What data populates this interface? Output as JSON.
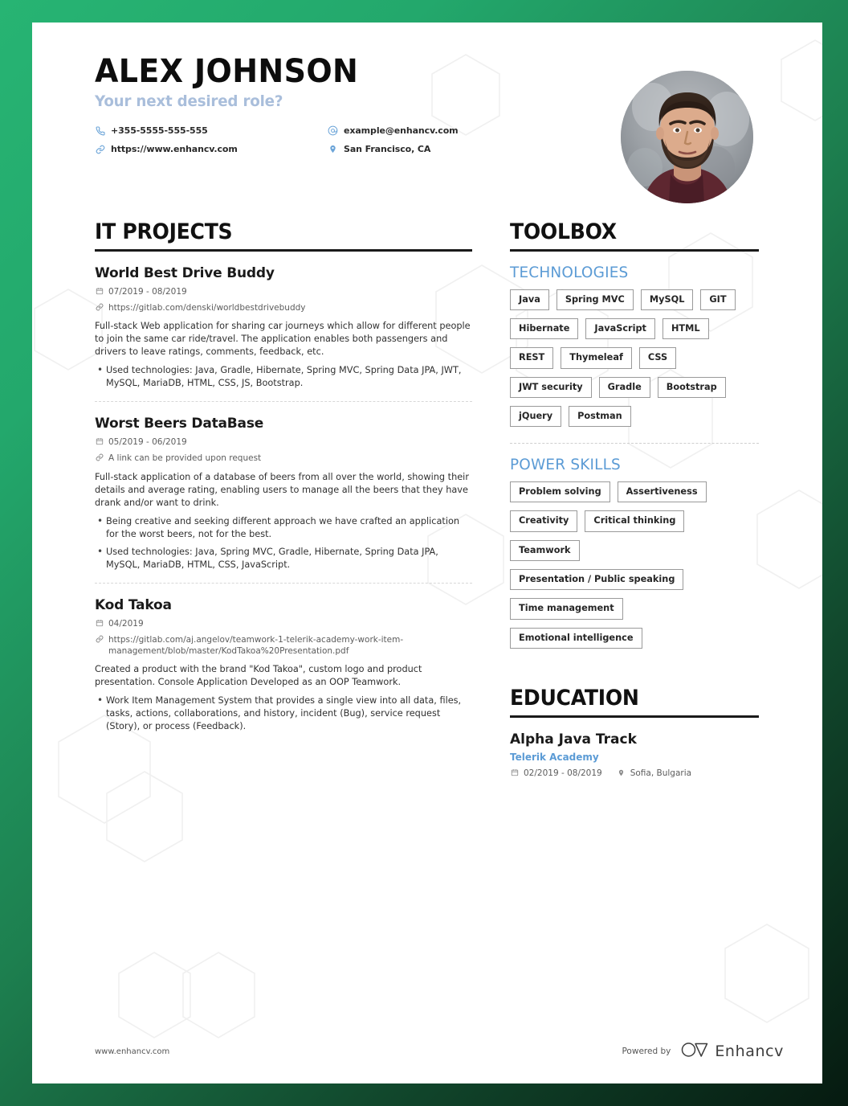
{
  "header": {
    "name": "ALEX JOHNSON",
    "subtitle": "Your next desired role?",
    "contacts": [
      {
        "icon": "phone-icon",
        "text": "+355-5555-555-555"
      },
      {
        "icon": "email-icon",
        "text": "example@enhancv.com"
      },
      {
        "icon": "link-icon",
        "text": "https://www.enhancv.com"
      },
      {
        "icon": "location-icon",
        "text": "San Francisco, CA"
      }
    ],
    "photo_alt": "Profile photo"
  },
  "projects": {
    "section_title": "IT PROJECTS",
    "items": [
      {
        "title": "World Best Drive Buddy",
        "date": "07/2019 - 08/2019",
        "link": "https://gitlab.com/denski/worldbestdrivebuddy",
        "description": "Full-stack Web application for sharing car journeys which allow for different people to join the same car ride/travel. The application enables both passengers and drivers to leave ratings, comments, feedback, etc.",
        "bullets": [
          "Used technologies: Java, Gradle, Hibernate, Spring MVC, Spring Data JPA, JWT, MySQL, MariaDB, HTML, CSS, JS, Bootstrap."
        ]
      },
      {
        "title": "Worst Beers DataBase",
        "date": "05/2019 - 06/2019",
        "link": "A link can be provided upon request",
        "description": "Full-stack application of a database of beers from all over the world, showing their details and average rating, enabling users to manage all the beers that they have drank and/or want to drink.",
        "bullets": [
          "Being creative and seeking different approach we have crafted an application for the worst beers, not for the best.",
          "Used technologies: Java, Spring MVC, Gradle, Hibernate, Spring Data JPA, MySQL, MariaDB, HTML, CSS, JavaScript."
        ]
      },
      {
        "title": "Kod Takoa",
        "date": "04/2019",
        "link": "https://gitlab.com/aj.angelov/teamwork-1-telerik-academy-work-item-management/blob/master/KodTakoa%20Presentation.pdf",
        "description": "Created a product with the brand \"Kod Takoa\", custom logo and product presentation. Console Application Developed as an OOP Teamwork.",
        "bullets": [
          "Work Item Management System that provides a single view into all data, files, tasks, actions, collaborations, and history, incident (Bug), service request (Story), or process (Feedback)."
        ]
      }
    ]
  },
  "toolbox": {
    "section_title": "TOOLBOX",
    "technologies_label": "TECHNOLOGIES",
    "technologies": [
      "Java",
      "Spring MVC",
      "MySQL",
      "GIT",
      "Hibernate",
      "JavaScript",
      "HTML",
      "REST",
      "Thymeleaf",
      "CSS",
      "JWT security",
      "Gradle",
      "Bootstrap",
      "jQuery",
      "Postman"
    ],
    "power_skills_label": "POWER SKILLS",
    "power_skills": [
      "Problem solving",
      "Assertiveness",
      "Creativity",
      "Critical thinking",
      "Teamwork",
      "Presentation / Public speaking",
      "Time management",
      "Emotional intelligence"
    ]
  },
  "education": {
    "section_title": "EDUCATION",
    "items": [
      {
        "degree": "Alpha Java Track",
        "organization": "Telerik Academy",
        "date": "02/2019 - 08/2019",
        "location": "Sofia, Bulgaria"
      }
    ]
  },
  "footer": {
    "url": "www.enhancv.com",
    "powered_by": "Powered by",
    "brand": "Enhancv"
  },
  "colors": {
    "accent_blue": "#5b9bd5",
    "subtitle_blue": "#a9bedb",
    "icon_blue": "#6ba4d8",
    "heading_black": "#111111",
    "border_green": "#27b473"
  }
}
